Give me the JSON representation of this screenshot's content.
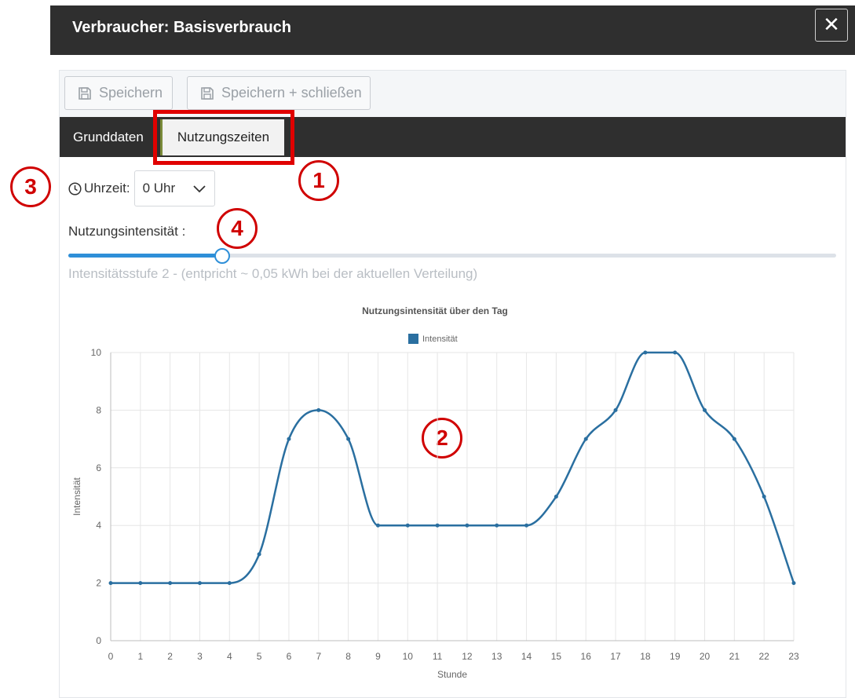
{
  "window": {
    "title": "Verbraucher: Basisverbrauch",
    "close_symbol": "✕"
  },
  "toolbar": {
    "save_label": "Speichern",
    "save_close_label": "Speichern + schließen"
  },
  "tabs": [
    {
      "label": "Grunddaten"
    },
    {
      "label": "Nutzungszeiten",
      "active": true
    }
  ],
  "callouts": [
    "1",
    "2",
    "3",
    "4"
  ],
  "time": {
    "label": "Uhrzeit:",
    "selected": "0 Uhr"
  },
  "intensity": {
    "label": "Nutzungsintensität :",
    "level": 2,
    "max": 10,
    "hint": "Intensitätsstufe 2 - (entpricht ~ 0,05 kWh bei der aktuellen Verteilung)"
  },
  "colors": {
    "accent": "#2e8fd8",
    "series": "#2a6fa0",
    "header": "#2f2f2f",
    "callout": "#d00000"
  },
  "chart_data": {
    "type": "line",
    "title": "Nutzungsintensität über den Tag",
    "xlabel": "Stunde",
    "ylabel": "Intensität",
    "ylim": [
      0,
      10
    ],
    "yticks": [
      0,
      2,
      4,
      6,
      8,
      10
    ],
    "grid": true,
    "legend": "top",
    "x": [
      0,
      1,
      2,
      3,
      4,
      5,
      6,
      7,
      8,
      9,
      10,
      11,
      12,
      13,
      14,
      15,
      16,
      17,
      18,
      19,
      20,
      21,
      22,
      23
    ],
    "series": [
      {
        "name": "Intensität",
        "values": [
          2,
          2,
          2,
          2,
          2,
          3,
          7,
          8,
          7,
          4,
          4,
          4,
          4,
          4,
          4,
          5,
          7,
          8,
          10,
          10,
          8,
          7,
          5,
          2
        ]
      }
    ]
  }
}
